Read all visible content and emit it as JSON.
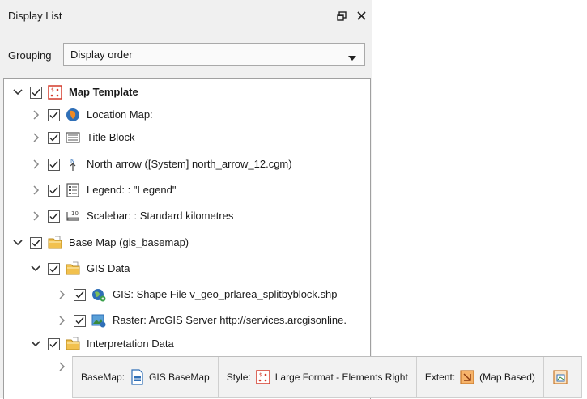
{
  "panel": {
    "title": "Display List",
    "grouping_label": "Grouping",
    "grouping_value": "Display order"
  },
  "tree": [
    {
      "label": "Map Template",
      "icon": "map-template-icon",
      "expanded": true,
      "checked": true,
      "level": 0,
      "bold": true
    },
    {
      "label": "Location Map:",
      "icon": "location-map-icon",
      "expanded": false,
      "checked": true,
      "level": 1
    },
    {
      "label": "Title Block",
      "icon": "title-block-icon",
      "expanded": false,
      "checked": true,
      "level": 1
    },
    {
      "label": "North arrow ([System]  north_arrow_12.cgm)",
      "icon": "north-arrow-icon",
      "expanded": false,
      "checked": true,
      "level": 1
    },
    {
      "label": "Legend: : \"Legend\"",
      "icon": "legend-icon",
      "expanded": false,
      "checked": true,
      "level": 1
    },
    {
      "label": "Scalebar: : Standard kilometres",
      "icon": "scalebar-icon",
      "expanded": false,
      "checked": true,
      "level": 1
    },
    {
      "label": "Base Map (gis_basemap)",
      "icon": "folder-icon",
      "expanded": true,
      "checked": true,
      "level": 0
    },
    {
      "label": "GIS Data",
      "icon": "folder-icon",
      "expanded": true,
      "checked": true,
      "level": 1
    },
    {
      "label": "GIS: Shape File v_geo_prlarea_splitbyblock.shp",
      "icon": "shapefile-icon",
      "expanded": false,
      "checked": true,
      "level": 2
    },
    {
      "label": "Raster: ArcGIS Server http://services.arcgisonline.",
      "icon": "raster-icon",
      "expanded": false,
      "checked": true,
      "level": 2
    },
    {
      "label": "Interpretation Data",
      "icon": "folder-icon",
      "expanded": true,
      "checked": true,
      "level": 1
    }
  ],
  "statusbar": {
    "basemap_label": "BaseMap:",
    "basemap_value": "GIS BaseMap",
    "style_label": "Style:",
    "style_value": "Large Format - Elements Right",
    "extent_label": "Extent:",
    "extent_value": "(Map Based)"
  },
  "colors": {
    "folder": "#f2c14e",
    "accent_red": "#d43a2a",
    "blue": "#2f6fb7"
  }
}
